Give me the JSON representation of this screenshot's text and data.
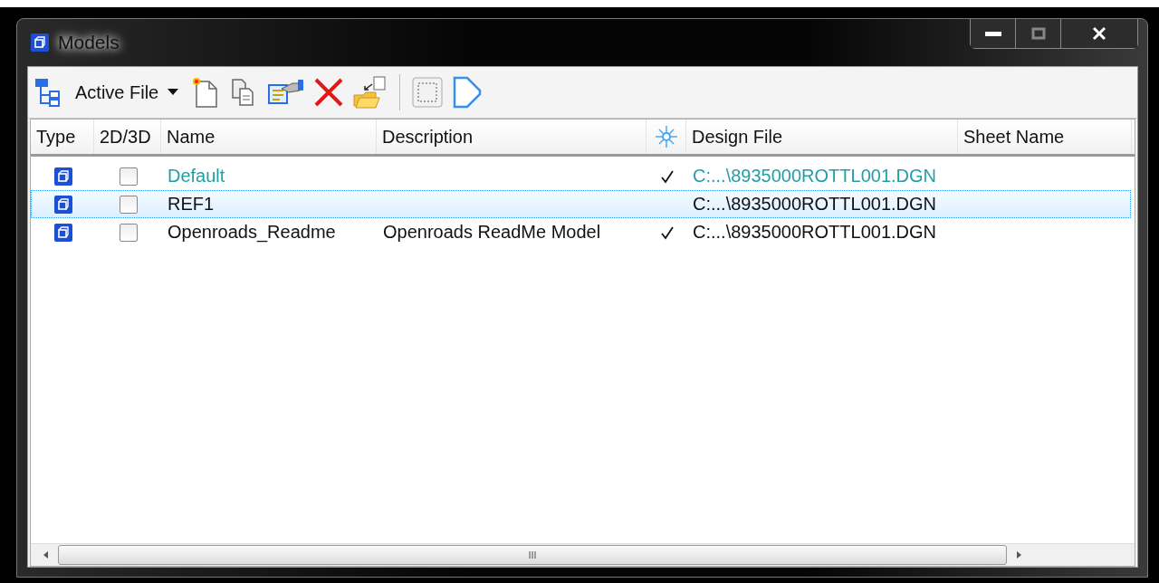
{
  "window": {
    "title": "Models"
  },
  "toolbar": {
    "dropdown": "Active File"
  },
  "table": {
    "columns": [
      {
        "label": "Type"
      },
      {
        "label": "2D/3D"
      },
      {
        "label": "Name"
      },
      {
        "label": "Description"
      },
      {
        "kind": "icon"
      },
      {
        "label": "Design File"
      },
      {
        "label": "Sheet Name"
      }
    ],
    "rows": [
      {
        "name": "Default",
        "displayed": true,
        "design_file": "C:...\\8935000ROTTL001.DGN",
        "active": true,
        "selected": false,
        "checked": false
      },
      {
        "name": "REF1",
        "displayed": false,
        "design_file": "C:...\\8935000ROTTL001.DGN",
        "active": false,
        "selected": true,
        "checked": false
      },
      {
        "name": "Openroads_Readme",
        "description": "Openroads ReadMe Model",
        "displayed": true,
        "design_file": "C:...\\8935000ROTTL001.DGN",
        "active": false,
        "selected": false,
        "checked": false
      }
    ]
  },
  "scrollbar": {
    "grip": "III"
  }
}
